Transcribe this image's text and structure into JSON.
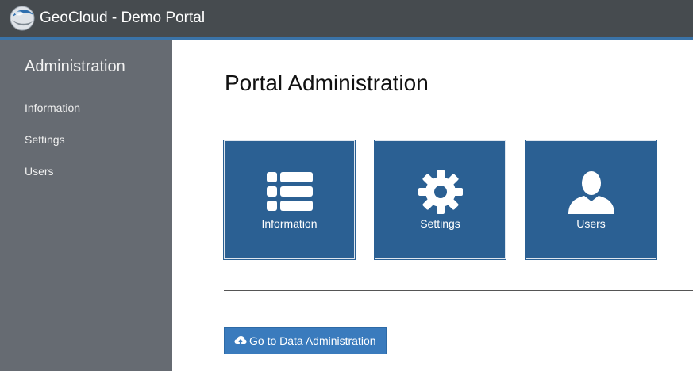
{
  "header": {
    "app_title": "GeoCloud - Demo Portal",
    "logo_icon": "geocloud-globe-logo"
  },
  "sidebar": {
    "heading": "Administration",
    "items": [
      {
        "label": "Information"
      },
      {
        "label": "Settings"
      },
      {
        "label": "Users"
      }
    ]
  },
  "main": {
    "title": "Portal Administration",
    "tiles": [
      {
        "label": "Information",
        "icon": "list-icon"
      },
      {
        "label": "Settings",
        "icon": "gear-icon"
      },
      {
        "label": "Users",
        "icon": "user-icon"
      }
    ],
    "data_admin_button": {
      "label": "Go to Data Administration",
      "icon": "cloud-upload-icon"
    }
  },
  "colors": {
    "topbar": "#464b4f",
    "accent": "#3a73a8",
    "sidebar": "#666b72",
    "tile": "#2b6093",
    "button": "#3a7bbd"
  }
}
